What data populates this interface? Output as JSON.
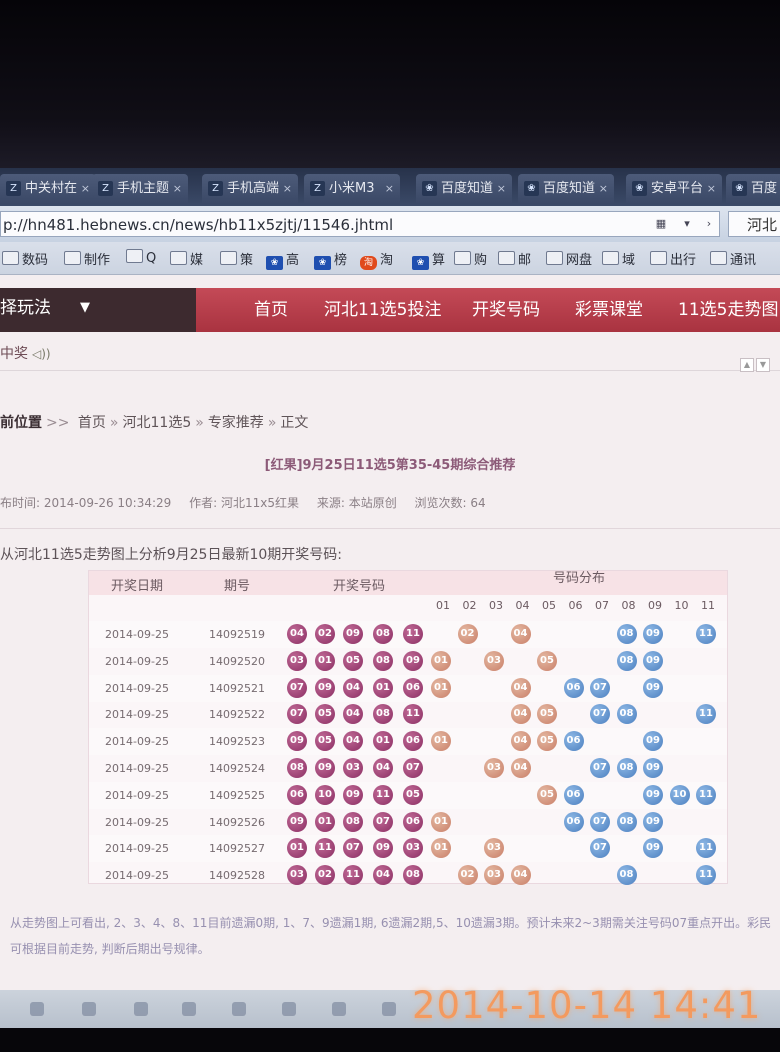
{
  "browser": {
    "tabs": [
      {
        "label": "中关村在",
        "icon": "zol"
      },
      {
        "label": "手机主题",
        "icon": "zol"
      },
      {
        "label": "手机高端",
        "icon": "zol"
      },
      {
        "label": "小米M3",
        "icon": "zol"
      },
      {
        "label": "百度知道",
        "icon": "paw"
      },
      {
        "label": "百度知道",
        "icon": "paw"
      },
      {
        "label": "安卓平台",
        "icon": "paw"
      },
      {
        "label": "百度",
        "icon": "paw"
      }
    ],
    "url": "p://hn481.hebnews.cn/news/hb11x5zjtj/11546.jhtml",
    "search_text": "河北",
    "bookmarks": [
      "数码",
      "制作",
      "Q",
      "媒",
      "策",
      "高",
      "榜",
      "淘",
      "算",
      "购",
      "邮",
      "网盘",
      "域",
      "出行",
      "通讯"
    ]
  },
  "site": {
    "play_menu_label": "选择玩法",
    "nav": [
      "首页",
      "河北11选5投注",
      "开奖号码",
      "彩票课堂",
      "11选5走势图"
    ],
    "notice_label": "中奖"
  },
  "breadcrumb": {
    "lead": "前位置",
    "items": [
      "首页",
      "河北11选5",
      "专家推荐",
      "正文"
    ]
  },
  "article": {
    "title": "[红果]9月25日11选5第35-45期综合推荐",
    "publish": "布时间: 2014-09-26 10:34:29",
    "author": "作者: 河北11x5红果",
    "source": "来源: 本站原创",
    "views": "浏览次数: 64",
    "intro": "从河北11选5走势图上分析9月25日最新10期开奖号码:",
    "summary": "从走势图上可看出, 2、3、4、8、11目前遗漏0期, 1、7、9遗漏1期, 6遗漏2期,5、10遗漏3期。预计未来2~3期需关注号码07重点开出。彩民可根据目前走势, 判断后期出号规律。"
  },
  "table": {
    "headers": {
      "date": "开奖日期",
      "issue": "期号",
      "draw": "开奖号码",
      "dist": "号码分布"
    },
    "numbers": [
      "01",
      "02",
      "03",
      "04",
      "05",
      "06",
      "07",
      "08",
      "09",
      "10",
      "11"
    ],
    "rows": [
      {
        "date": "2014-09-25",
        "issue": "14092519",
        "draw": [
          "04",
          "02",
          "09",
          "08",
          "11"
        ],
        "dist": {
          "02": "r",
          "04": "r",
          "08": "b",
          "09": "b",
          "11": "b"
        }
      },
      {
        "date": "2014-09-25",
        "issue": "14092520",
        "draw": [
          "03",
          "01",
          "05",
          "08",
          "09"
        ],
        "dist": {
          "01": "r",
          "03": "r",
          "05": "r",
          "08": "b",
          "09": "b"
        }
      },
      {
        "date": "2014-09-25",
        "issue": "14092521",
        "draw": [
          "07",
          "09",
          "04",
          "01",
          "06"
        ],
        "dist": {
          "01": "r",
          "04": "r",
          "06": "b",
          "07": "b",
          "09": "b"
        }
      },
      {
        "date": "2014-09-25",
        "issue": "14092522",
        "draw": [
          "07",
          "05",
          "04",
          "08",
          "11"
        ],
        "dist": {
          "04": "r",
          "05": "r",
          "07": "b",
          "08": "b",
          "11": "b"
        }
      },
      {
        "date": "2014-09-25",
        "issue": "14092523",
        "draw": [
          "09",
          "05",
          "04",
          "01",
          "06"
        ],
        "dist": {
          "01": "r",
          "04": "r",
          "05": "r",
          "06": "b",
          "09": "b"
        }
      },
      {
        "date": "2014-09-25",
        "issue": "14092524",
        "draw": [
          "08",
          "09",
          "03",
          "04",
          "07"
        ],
        "dist": {
          "03": "r",
          "04": "r",
          "07": "b",
          "08": "b",
          "09": "b"
        }
      },
      {
        "date": "2014-09-25",
        "issue": "14092525",
        "draw": [
          "06",
          "10",
          "09",
          "11",
          "05"
        ],
        "dist": {
          "05": "r",
          "06": "b",
          "09": "b",
          "10": "b",
          "11": "b"
        }
      },
      {
        "date": "2014-09-25",
        "issue": "14092526",
        "draw": [
          "09",
          "01",
          "08",
          "07",
          "06"
        ],
        "dist": {
          "01": "r",
          "06": "b",
          "07": "b",
          "08": "b",
          "09": "b"
        }
      },
      {
        "date": "2014-09-25",
        "issue": "14092527",
        "draw": [
          "01",
          "11",
          "07",
          "09",
          "03"
        ],
        "dist": {
          "01": "r",
          "03": "r",
          "07": "b",
          "09": "b",
          "11": "b"
        }
      },
      {
        "date": "2014-09-25",
        "issue": "14092528",
        "draw": [
          "03",
          "02",
          "11",
          "04",
          "08"
        ],
        "dist": {
          "02": "r",
          "03": "r",
          "04": "r",
          "08": "b",
          "11": "b"
        }
      }
    ]
  },
  "photo_timestamp": "2014-10-14 14:41",
  "colors": {
    "nav_red": "#b13c49",
    "ball_purple": "#8b2e63",
    "ball_red": "#c97e67",
    "ball_blue": "#4b7fbf",
    "stamp": "#f39a5f"
  }
}
